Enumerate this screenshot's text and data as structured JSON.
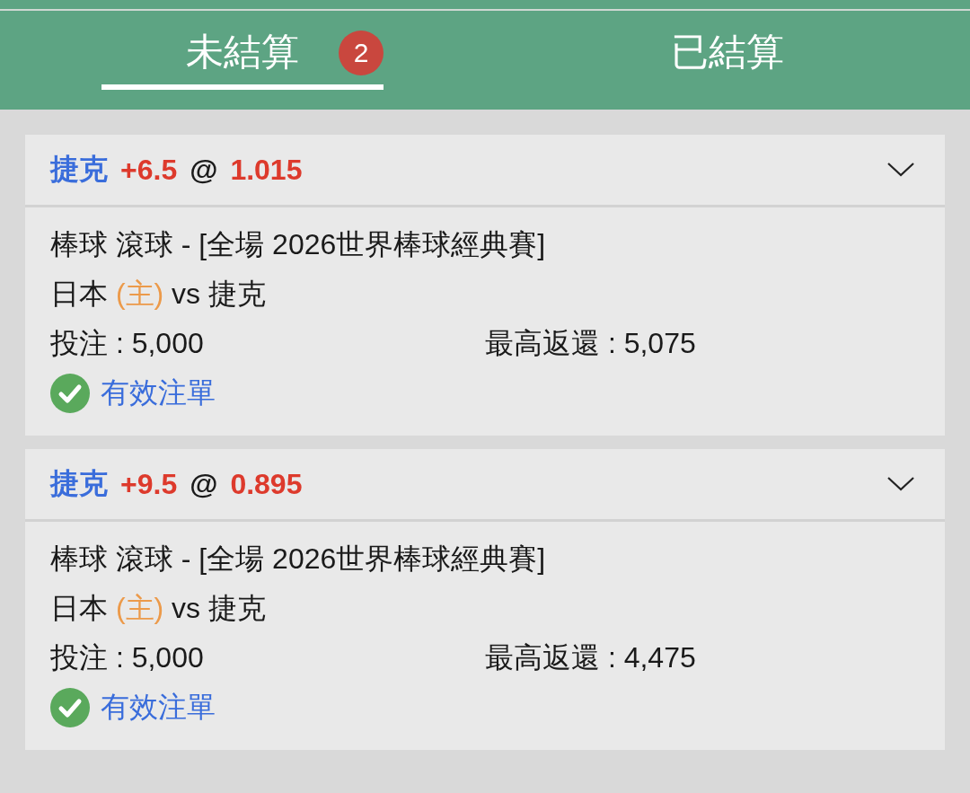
{
  "tabs": [
    {
      "label": "未結算",
      "selected": true,
      "badge": "2"
    },
    {
      "label": "已結算",
      "selected": false
    }
  ],
  "bets": [
    {
      "team": "捷克",
      "handicap": "+6.5",
      "at": "@",
      "odds": "1.015",
      "market": "棒球 滾球 - [全場 2026世界棒球經典賽]",
      "home": "日本",
      "home_tag": "(主)",
      "vs": "vs",
      "away": "捷克",
      "stake": "投注 : 5,000",
      "max_return": "最高返還 : 5,075",
      "status": "有效注單"
    },
    {
      "team": "捷克",
      "handicap": "+9.5",
      "at": "@",
      "odds": "0.895",
      "market": "棒球 滾球 - [全場 2026世界棒球經典賽]",
      "home": "日本",
      "home_tag": "(主)",
      "vs": "vs",
      "away": "捷克",
      "stake": "投注 : 5,000",
      "max_return": "最高返還 : 4,475",
      "status": "有效注單"
    }
  ]
}
